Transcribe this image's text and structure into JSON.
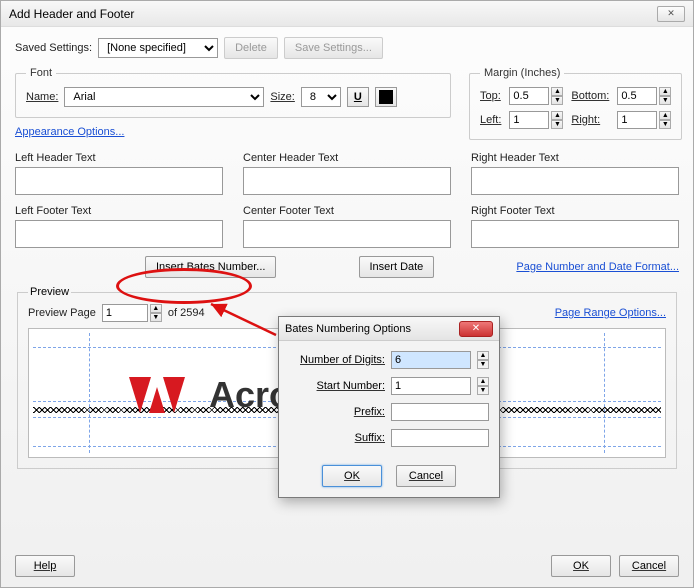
{
  "window": {
    "title": "Add Header and Footer"
  },
  "saved": {
    "label": "Saved Settings:",
    "value": "[None specified]",
    "delete": "Delete",
    "save": "Save Settings..."
  },
  "font": {
    "legend": "Font",
    "name_label": "Name:",
    "name_value": "Arial",
    "size_label": "Size:",
    "size_value": "8",
    "underline_btn": "U"
  },
  "margin": {
    "legend": "Margin (Inches)",
    "top_label": "Top:",
    "top_value": "0.5",
    "bottom_label": "Bottom:",
    "bottom_value": "0.5",
    "left_label": "Left:",
    "left_value": "1",
    "right_label": "Right:",
    "right_value": "1"
  },
  "appearance_link": "Appearance Options...",
  "hf": {
    "lh": "Left Header Text",
    "ch": "Center Header Text",
    "rh": "Right Header Text",
    "lf": "Left Footer Text",
    "cf": "Center Footer Text",
    "rf": "Right Footer Text",
    "vals": {
      "lh": "",
      "ch": "",
      "rh": "",
      "lf": "",
      "cf": "",
      "rf": ""
    }
  },
  "insert": {
    "bates": "Insert Bates Number...",
    "date": "Insert Date",
    "format_link": "Page Number and Date Format..."
  },
  "preview": {
    "legend": "Preview",
    "page_label": "Preview Page",
    "page_value": "1",
    "page_total": "of 2594",
    "range_link": "Page Range Options...",
    "logo_text": "Acro            PI"
  },
  "buttons": {
    "help": "Help",
    "ok": "OK",
    "cancel": "Cancel"
  },
  "modal": {
    "title": "Bates Numbering Options",
    "digits_label": "Number of Digits:",
    "digits_value": "6",
    "start_label": "Start Number:",
    "start_value": "1",
    "prefix_label": "Prefix:",
    "prefix_value": "",
    "suffix_label": "Suffix:",
    "suffix_value": "",
    "ok": "OK",
    "cancel": "Cancel"
  }
}
